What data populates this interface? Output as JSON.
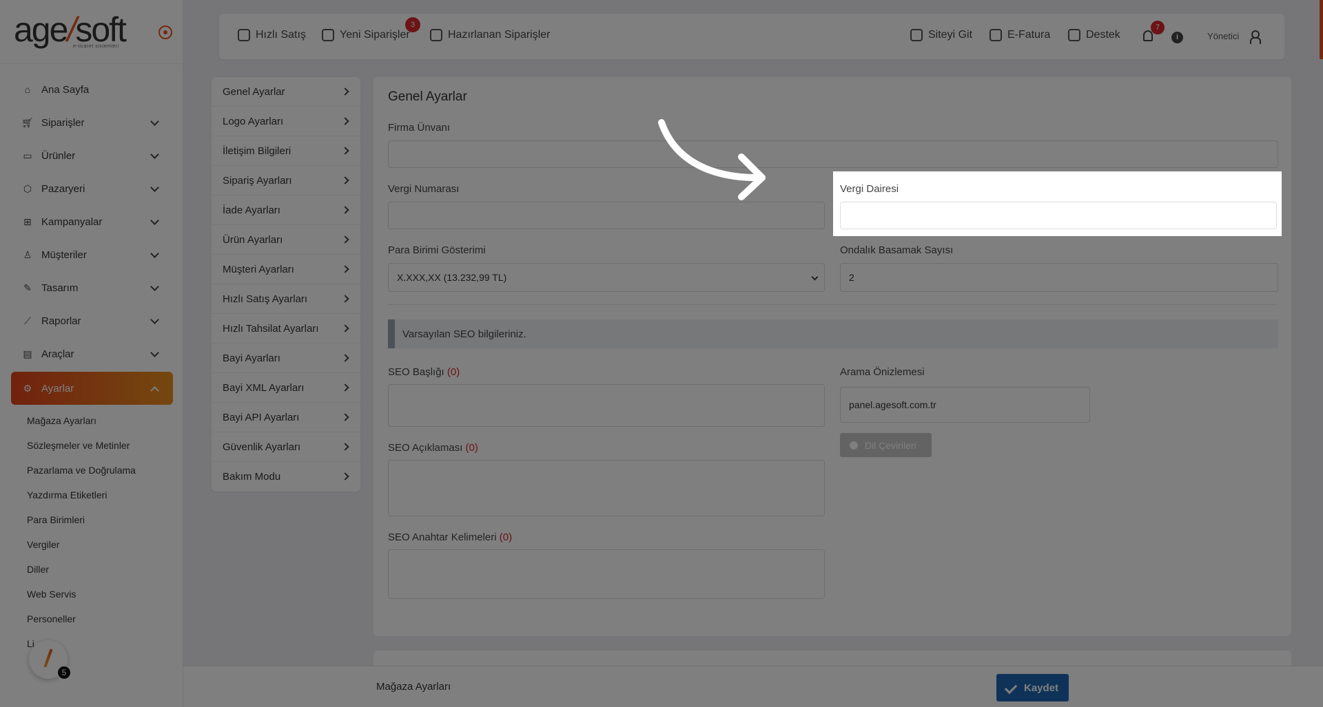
{
  "sidebar": {
    "logo": {
      "text_main": "age",
      "text_slash": "/",
      "text_soft": "soft",
      "tagline": "e-ticaret sistemleri"
    },
    "nav": [
      {
        "label": "Ana Sayfa",
        "icon": "home-icon",
        "expandable": false
      },
      {
        "label": "Siparişler",
        "icon": "cart-icon",
        "expandable": true
      },
      {
        "label": "Ürünler",
        "icon": "book-icon",
        "expandable": true
      },
      {
        "label": "Pazaryeri",
        "icon": "box-icon",
        "expandable": true
      },
      {
        "label": "Kampanyalar",
        "icon": "gift-icon",
        "expandable": true
      },
      {
        "label": "Müşteriler",
        "icon": "user-icon",
        "expandable": true
      },
      {
        "label": "Tasarım",
        "icon": "edit-icon",
        "expandable": true
      },
      {
        "label": "Raporlar",
        "icon": "chart-icon",
        "expandable": true
      },
      {
        "label": "Araçlar",
        "icon": "clipboard-icon",
        "expandable": true
      },
      {
        "label": "Ayarlar",
        "icon": "gear-icon",
        "expandable": true,
        "active": true
      }
    ],
    "sub_items": [
      "Mağaza Ayarları",
      "Sözleşmeler ve Metinler",
      "Pazarlama ve Doğrulama",
      "Yazdırma Etiketleri",
      "Para Birimleri",
      "Vergiler",
      "Diller",
      "Web Servis",
      "Personeller",
      "Li"
    ],
    "floating_badge": "5"
  },
  "topbar": {
    "left": [
      {
        "label": "Hızlı Satış",
        "icon": "quick-sale-icon"
      },
      {
        "label": "Yeni Siparişler",
        "icon": "cart-icon",
        "badge": "3"
      },
      {
        "label": "Hazırlanan Siparişler",
        "icon": "package-icon"
      }
    ],
    "right": [
      {
        "label": "Siteyi Git",
        "icon": "site-icon"
      },
      {
        "label": "E-Fatura",
        "icon": "invoice-icon"
      },
      {
        "label": "Destek",
        "icon": "headset-icon"
      }
    ],
    "notification_count": "7",
    "info_glyph": "i",
    "user_label": "Yönetici"
  },
  "settings_menu": [
    "Genel Ayarlar",
    "Logo Ayarları",
    "İletişim Bilgileri",
    "Sipariş Ayarları",
    "İade Ayarları",
    "Ürün Ayarları",
    "Müşteri Ayarları",
    "Hızlı Satış Ayarları",
    "Hızlı Tahsilat Ayarları",
    "Bayi Ayarları",
    "Bayi XML Ayarları",
    "Bayi API Ayarları",
    "Güvenlik Ayarları",
    "Bakım Modu"
  ],
  "form": {
    "title": "Genel Ayarlar",
    "firma_unvani": {
      "label": "Firma Ünvanı",
      "value": ""
    },
    "vergi_numarasi": {
      "label": "Vergi Numarası",
      "value": ""
    },
    "vergi_dairesi": {
      "label": "Vergi Dairesi",
      "value": ""
    },
    "para_birimi": {
      "label": "Para Birimi Gösterimi",
      "value": "X.XXX,XX (13.232,99 TL)"
    },
    "ondalik": {
      "label": "Ondalık Basamak Sayısı",
      "value": "2"
    },
    "seo_info": "Varsayılan SEO bilgileriniz.",
    "seo_baslik": {
      "label": "SEO Başlığı",
      "count": "(0)"
    },
    "seo_aciklama": {
      "label": "SEO Açıklaması",
      "count": "(0)"
    },
    "seo_anahtar": {
      "label": "SEO Anahtar Kelimeleri",
      "count": "(0)"
    },
    "arama_onizleme": {
      "label": "Arama Önizlemesi",
      "value": "panel.agesoft.com.tr"
    },
    "dil_button": "Dil Çevirileri"
  },
  "bottombar": {
    "title": "Mağaza Ayarları",
    "save_label": "Kaydet"
  },
  "colors": {
    "accent": "#e8541e",
    "save": "#1f67b1",
    "badge": "#d9262b"
  }
}
